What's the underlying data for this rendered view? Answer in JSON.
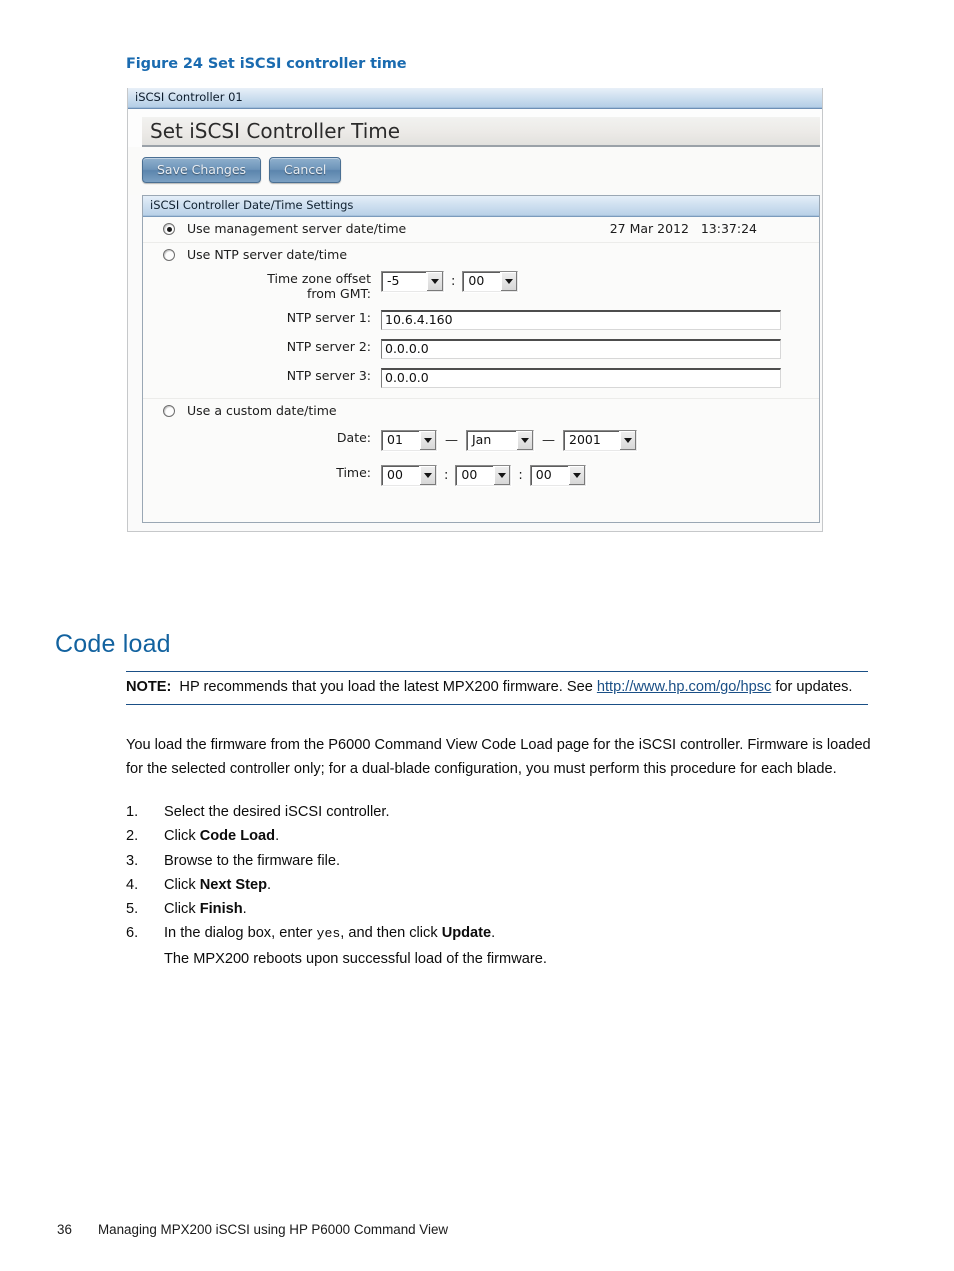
{
  "figure": {
    "caption": "Figure 24 Set iSCSI controller time"
  },
  "screenshot": {
    "titlebar": "iSCSI Controller 01",
    "page_heading": "Set iSCSI Controller Time",
    "buttons": {
      "save": "Save Changes",
      "cancel": "Cancel"
    },
    "group": {
      "header": "iSCSI Controller Date/Time Settings",
      "option_mgmt": {
        "label": "Use management server date/time",
        "selected": true,
        "datetime": "27 Mar 2012   13:37:24"
      },
      "option_ntp": {
        "label": "Use NTP server date/time",
        "selected": false,
        "timezone_label_line1": "Time zone offset",
        "timezone_label_line2": "from GMT:",
        "timezone_hours": "-5",
        "timezone_minutes": "00",
        "timezone_separator": ":",
        "ntp1_label": "NTP server 1:",
        "ntp1_value": "10.6.4.160",
        "ntp2_label": "NTP server 2:",
        "ntp2_value": "0.0.0.0",
        "ntp3_label": "NTP server 3:",
        "ntp3_value": "0.0.0.0"
      },
      "option_custom": {
        "label": "Use a custom date/time",
        "selected": false,
        "date_label": "Date:",
        "date_day": "01",
        "date_month": "Jan",
        "date_year": "2001",
        "date_separator": "—",
        "time_label": "Time:",
        "time_hours": "00",
        "time_minutes": "00",
        "time_seconds": "00",
        "time_separator": ":"
      }
    }
  },
  "section": {
    "heading": "Code load"
  },
  "note": {
    "label": "NOTE:",
    "text_before": "HP recommends that you load the latest MPX200 firmware. See ",
    "link": "http://www.hp.com/go/hpsc",
    "text_after": " for updates."
  },
  "paragraph": "You load the firmware from the P6000 Command View Code Load page for the iSCSI controller. Firmware is loaded for the selected controller only; for a dual-blade configuration, you must perform this procedure for each blade.",
  "steps": [
    {
      "num": "1.",
      "pre": "Select the desired iSCSI controller.",
      "bold": "",
      "post": ""
    },
    {
      "num": "2.",
      "pre": "Click ",
      "bold": "Code Load",
      "post": "."
    },
    {
      "num": "3.",
      "pre": "Browse to the firmware file.",
      "bold": "",
      "post": ""
    },
    {
      "num": "4.",
      "pre": "Click ",
      "bold": "Next Step",
      "post": "."
    },
    {
      "num": "5.",
      "pre": "Click ",
      "bold": "Finish",
      "post": "."
    },
    {
      "num": "6.",
      "pre": "In the dialog box, enter ",
      "code": "yes",
      "mid": ", and then click ",
      "bold": "Update",
      "post": "."
    }
  ],
  "step_sub": "The MPX200 reboots upon successful load of the firmware.",
  "footer": {
    "page_number": "36",
    "title": "Managing MPX200 iSCSI using HP P6000 Command View"
  },
  "colors": {
    "heading_blue": "#12629f",
    "caption_blue": "#1a6bb0",
    "link_blue": "#1a4f86",
    "titlebar_blue": "#b4cee6",
    "button_blue": "#6d94b9"
  }
}
